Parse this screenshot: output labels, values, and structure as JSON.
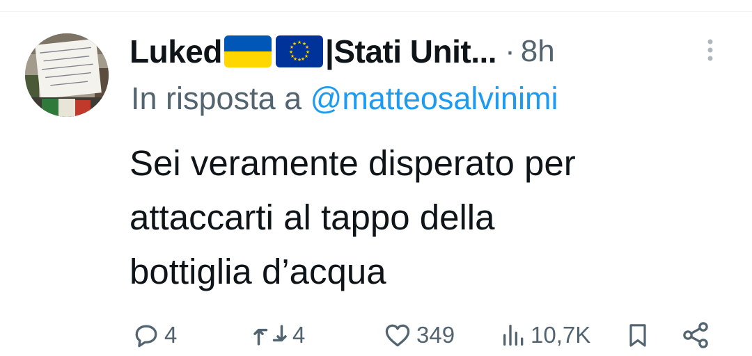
{
  "tweet": {
    "author_name": "Luked",
    "author_suffix": "|Stati Unit...",
    "separator": "·",
    "time": "8h",
    "reply_prefix": "In risposta a",
    "reply_handle": "@matteosalvinimi",
    "text_lines": [
      "Sei veramente disperato per",
      "attaccarti al tappo della",
      "bottiglia d’acqua"
    ],
    "avatar_sign_text": "NON CI HA LIBERATI IL PACIFISMO MA LE ARMI ARMIAMO LA RESISTENZA UCRAINA"
  },
  "flags": [
    {
      "icon": "ukraine-flag-icon",
      "colors": [
        "#0057b7",
        "#ffd700"
      ]
    },
    {
      "icon": "eu-flag-icon",
      "colors": [
        "#003399",
        "#ffcc00"
      ]
    }
  ],
  "actions": {
    "reply_count": "4",
    "retweet_count": "4",
    "like_count": "349",
    "views_count": "10,7K"
  },
  "colors": {
    "text": "#0f1419",
    "secondary": "#536471",
    "link": "#1d9bf0"
  }
}
